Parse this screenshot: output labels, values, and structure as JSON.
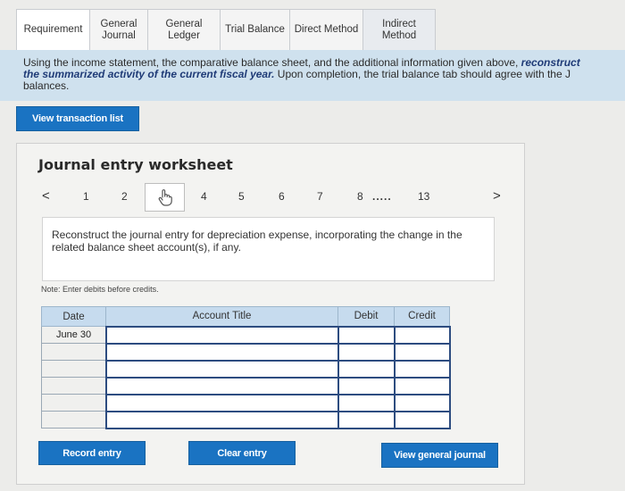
{
  "tabs": [
    {
      "label": "Requirement",
      "state": "active"
    },
    {
      "label": "General Journal",
      "state": "normal"
    },
    {
      "label": "General Ledger",
      "state": "normal"
    },
    {
      "label": "Trial Balance",
      "state": "normal"
    },
    {
      "label": "Direct Method",
      "state": "normal"
    },
    {
      "label": "Indirect Method",
      "state": "dim"
    }
  ],
  "instructions": {
    "line1": "Using the income statement, the comparative balance sheet, and the additional information given above, ",
    "line1_emph": "reconstruct",
    "line2_emph": "the summarized activity of the current fiscal year.",
    "line2": " Upon completion, the trial balance tab should agree with the J",
    "line3": "balances."
  },
  "view_transaction_list": "View transaction list",
  "worksheet": {
    "title": "Journal entry worksheet",
    "pager": {
      "prev": "<",
      "next": ">",
      "pages": [
        "1",
        "2",
        "4",
        "5",
        "6",
        "7",
        "8",
        ".....",
        "13"
      ],
      "current_icon": "hand-pointer-icon"
    },
    "description": "Reconstruct the journal entry for depreciation expense, incorporating the change in the related balance sheet account(s), if any.",
    "note": "Note: Enter debits before credits.",
    "table": {
      "headers": [
        "Date",
        "Account Title",
        "Debit",
        "Credit"
      ],
      "rows": [
        {
          "date": "June 30"
        },
        {
          "date": ""
        },
        {
          "date": ""
        },
        {
          "date": ""
        },
        {
          "date": ""
        },
        {
          "date": ""
        }
      ]
    },
    "buttons": {
      "record": "Record entry",
      "clear": "Clear entry",
      "view_journal": "View general journal"
    }
  }
}
